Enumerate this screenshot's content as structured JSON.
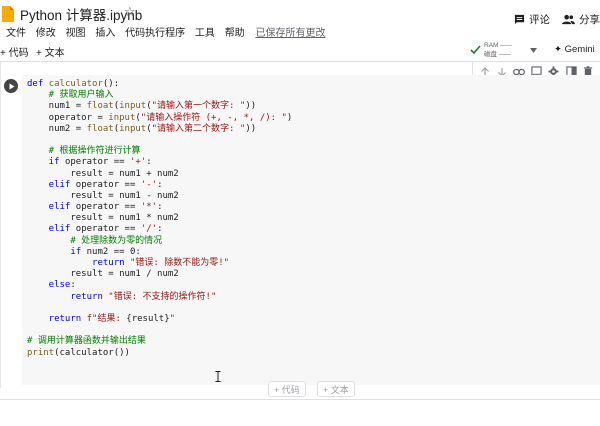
{
  "header": {
    "title": "Python 计算器.ipynb",
    "star": "☆",
    "menu": [
      "文件",
      "修改",
      "视图",
      "插入",
      "代码执行程序",
      "工具",
      "帮助"
    ],
    "saved_status": "已保存所有更改",
    "comment_label": "评论",
    "share_label": "分享"
  },
  "toolbar": {
    "add_code": "+ 代码",
    "add_text": "+ 文本",
    "ram_label": "RAM",
    "disk_label": "磁盘",
    "gemini_label": "Gemini"
  },
  "cell": {
    "code": [
      {
        "segments": [
          [
            "kw",
            "def "
          ],
          [
            "fn",
            "calculator"
          ],
          [
            "",
            "():"
          ]
        ]
      },
      {
        "segments": [
          [
            "cm",
            "    # 获取用户输入"
          ]
        ]
      },
      {
        "segments": [
          [
            "",
            "    num1 = "
          ],
          [
            "bi",
            "float"
          ],
          [
            "",
            "("
          ],
          [
            "bi",
            "input"
          ],
          [
            "",
            "("
          ],
          [
            "st",
            "\"请输入第一个数字: \""
          ],
          [
            "",
            "))"
          ]
        ]
      },
      {
        "segments": [
          [
            "",
            "    operator = "
          ],
          [
            "bi",
            "input"
          ],
          [
            "",
            "("
          ],
          [
            "st",
            "\"请输入操作符 (+, -, *, /): \""
          ],
          [
            "",
            ")"
          ]
        ]
      },
      {
        "segments": [
          [
            "",
            "    num2 = "
          ],
          [
            "bi",
            "float"
          ],
          [
            "",
            "("
          ],
          [
            "bi",
            "input"
          ],
          [
            "",
            "("
          ],
          [
            "st",
            "\"请输入第二个数字: \""
          ],
          [
            "",
            "))"
          ]
        ]
      },
      {
        "segments": [
          [
            "",
            ""
          ]
        ]
      },
      {
        "segments": [
          [
            "cm",
            "    # 根据操作符进行计算"
          ]
        ]
      },
      {
        "segments": [
          [
            "kw",
            "    if "
          ],
          [
            "",
            "operator == "
          ],
          [
            "st",
            "'+'"
          ],
          [
            "",
            ":"
          ]
        ]
      },
      {
        "segments": [
          [
            "",
            "        result = num1 + num2"
          ]
        ]
      },
      {
        "segments": [
          [
            "kw",
            "    elif "
          ],
          [
            "",
            "operator == "
          ],
          [
            "st",
            "'-'"
          ],
          [
            "",
            ":"
          ]
        ]
      },
      {
        "segments": [
          [
            "",
            "        result = num1 - num2"
          ]
        ]
      },
      {
        "segments": [
          [
            "kw",
            "    elif "
          ],
          [
            "",
            "operator == "
          ],
          [
            "st",
            "'*'"
          ],
          [
            "",
            ":"
          ]
        ]
      },
      {
        "segments": [
          [
            "",
            "        result = num1 * num2"
          ]
        ]
      },
      {
        "segments": [
          [
            "kw",
            "    elif "
          ],
          [
            "",
            "operator == "
          ],
          [
            "st",
            "'/'"
          ],
          [
            "",
            ":"
          ]
        ]
      },
      {
        "segments": [
          [
            "cm",
            "        # 处理除数为零的情况"
          ]
        ]
      },
      {
        "segments": [
          [
            "kw",
            "        if "
          ],
          [
            "",
            "num2 == 0:"
          ]
        ]
      },
      {
        "segments": [
          [
            "kw",
            "            return "
          ],
          [
            "st",
            "\"错误: 除数不能为零!\""
          ]
        ]
      },
      {
        "segments": [
          [
            "",
            "        result = num1 / num2"
          ]
        ]
      },
      {
        "segments": [
          [
            "kw",
            "    else"
          ],
          [
            "",
            ":"
          ]
        ]
      },
      {
        "segments": [
          [
            "kw",
            "        return "
          ],
          [
            "st",
            "\"错误: 不支持的操作符!\""
          ]
        ]
      },
      {
        "segments": [
          [
            "",
            ""
          ]
        ]
      },
      {
        "segments": [
          [
            "kw",
            "    return "
          ],
          [
            "st",
            "f\"结果: "
          ],
          [
            "",
            "{result}"
          ],
          [
            "st",
            "\""
          ]
        ]
      },
      {
        "segments": [
          [
            "",
            ""
          ]
        ]
      },
      {
        "segments": [
          [
            "cm",
            "# 调用计算器函数并输出结果"
          ]
        ]
      },
      {
        "segments": [
          [
            "bi",
            "print"
          ],
          [
            "",
            "(calculator())"
          ]
        ]
      }
    ]
  },
  "below_cell": {
    "add_code": "+ 代码",
    "add_text": "+ 文本"
  },
  "colors": {
    "keyword": "#0000ff",
    "string": "#a31515",
    "comment": "#008000",
    "builtin": "#795e26",
    "cell_bg": "#f7f7f7"
  }
}
